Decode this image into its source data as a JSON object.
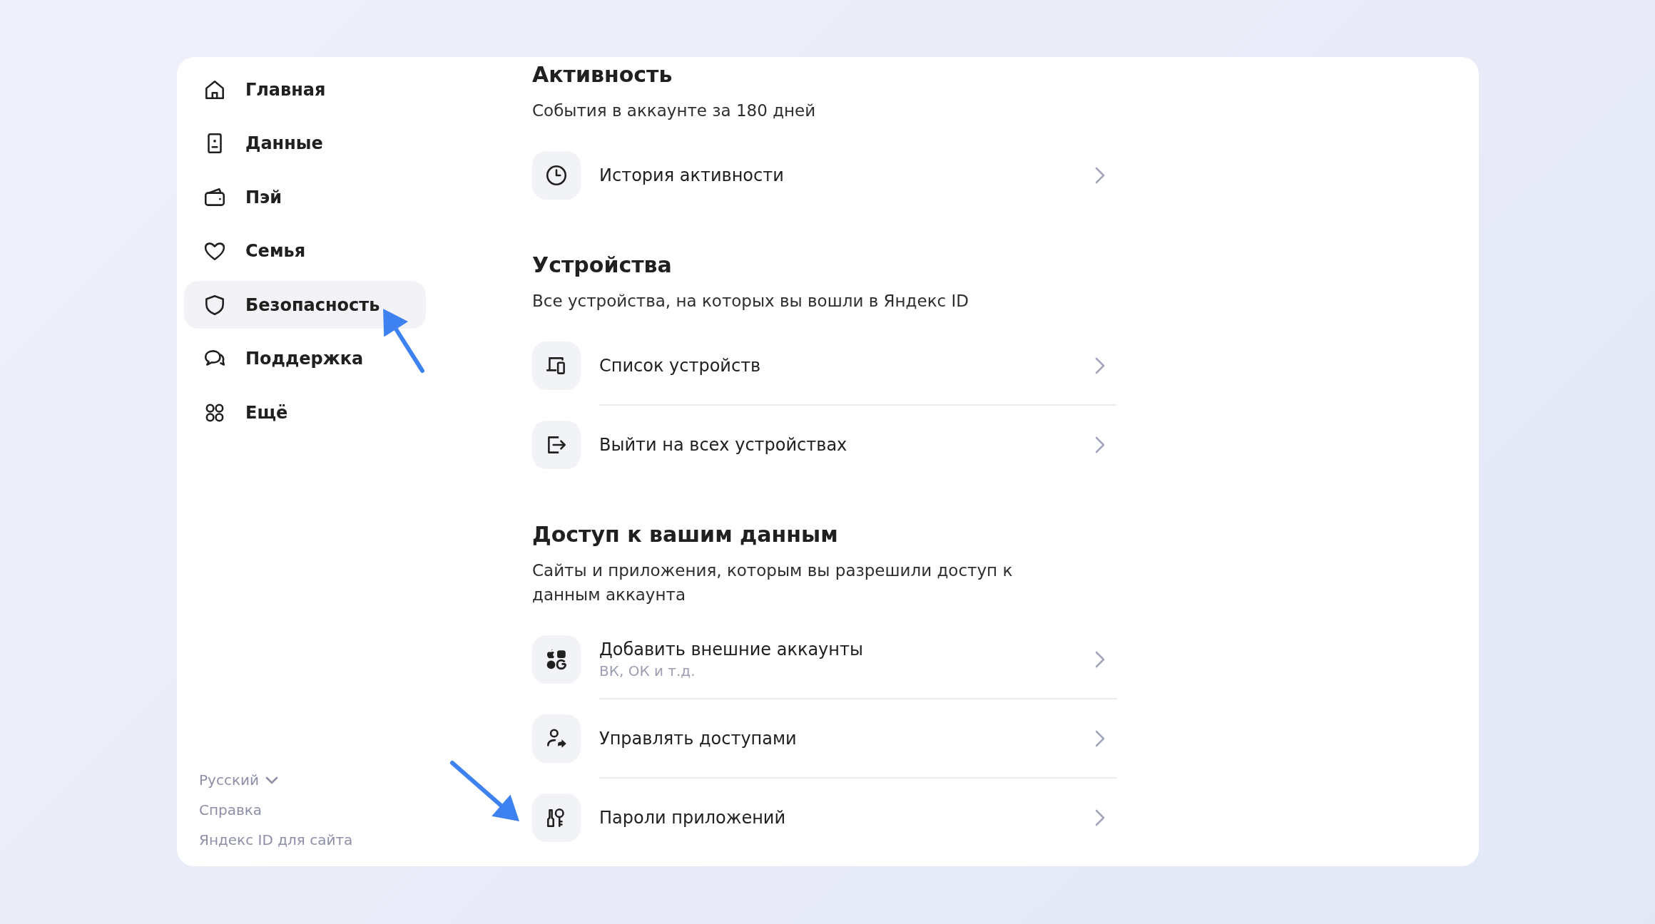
{
  "sidebar": {
    "items": [
      {
        "label": "Главная",
        "selected": false
      },
      {
        "label": "Данные",
        "selected": false
      },
      {
        "label": "Пэй",
        "selected": false
      },
      {
        "label": "Семья",
        "selected": false
      },
      {
        "label": "Безопасность",
        "selected": true
      },
      {
        "label": "Поддержка",
        "selected": false
      },
      {
        "label": "Ещё",
        "selected": false
      }
    ],
    "footer": {
      "language": "Русский",
      "links": [
        "Справка",
        "Яндекс ID для сайта"
      ]
    }
  },
  "sections": [
    {
      "title": "Активность",
      "subtitle": "События в аккаунте за 180 дней",
      "rows": [
        {
          "label": "История активности"
        }
      ]
    },
    {
      "title": "Устройства",
      "subtitle": "Все устройства, на которых вы вошли в Яндекс ID",
      "rows": [
        {
          "label": "Список устройств"
        },
        {
          "label": "Выйти на всех устройствах"
        }
      ]
    },
    {
      "title": "Доступ к вашим данным",
      "subtitle": "Сайты и приложения, которым вы разрешили доступ к данным аккаунта",
      "rows": [
        {
          "label": "Добавить внешние аккаунты",
          "sublabel": "ВК, ОК и т.д."
        },
        {
          "label": "Управлять доступами"
        },
        {
          "label": "Пароли приложений"
        }
      ]
    }
  ]
}
